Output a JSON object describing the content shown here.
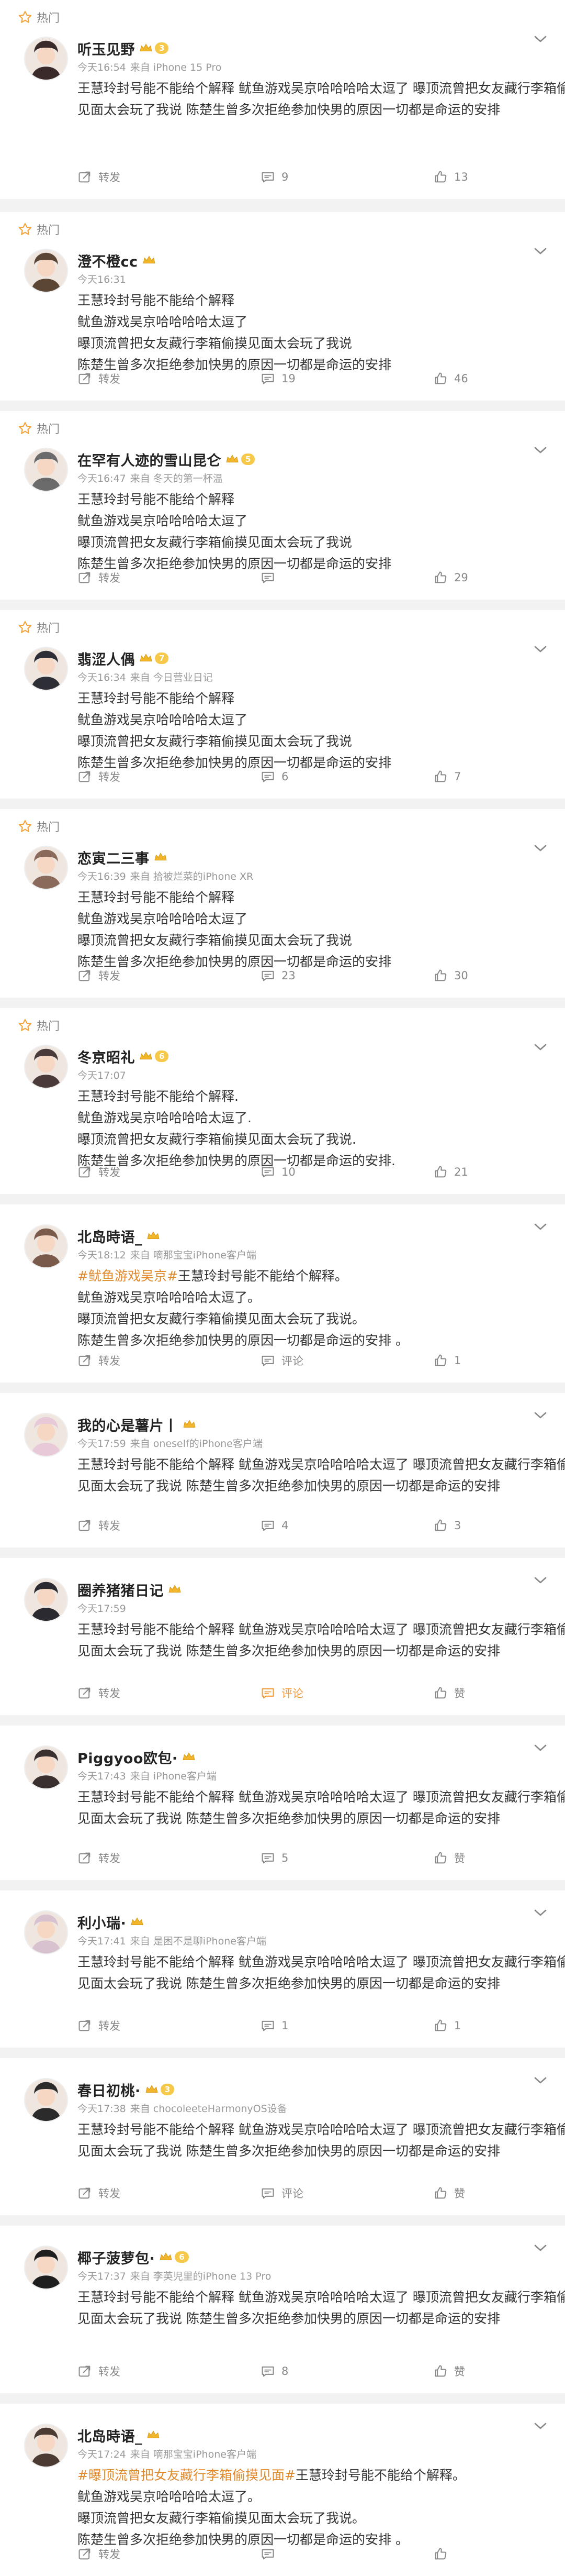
{
  "hot_label": "热门",
  "actions": {
    "forward": "转发",
    "comment_word": "评论",
    "like_word": "赞"
  },
  "colors": {
    "accent": "#f29a38",
    "tag": "#e08a2c",
    "text": "#333333",
    "meta": "#999999",
    "vip": "#f7c94a"
  },
  "icons": [
    "star-icon",
    "chevron-down-icon",
    "forward-icon",
    "comment-icon",
    "like-icon",
    "crown-icon"
  ],
  "comments": [
    {
      "hot": true,
      "name": "听玉见野",
      "vip": true,
      "vip_level": "3",
      "time": "今天16:54",
      "source": "来自 iPhone 15 Pro",
      "lines": [
        "王慧玲封号能不能给个解释 鱿鱼游戏吴京哈哈哈哈太逗了 曝顶流曾把女友藏行李箱偷摸",
        "见面太会玩了我说 陈楚生曾多次拒绝参加快男的原因一切都是命运的安排"
      ],
      "comments": "9",
      "likes": "13"
    },
    {
      "hot": true,
      "name": "澄不橙cc",
      "vip": true,
      "vip_level": "",
      "time": "今天16:31",
      "source": "",
      "lines": [
        "王慧玲封号能不能给个解释",
        "鱿鱼游戏吴京哈哈哈哈太逗了",
        "曝顶流曾把女友藏行李箱偷摸见面太会玩了我说",
        "陈楚生曾多次拒绝参加快男的原因一切都是命运的安排"
      ],
      "comments": "19",
      "likes": "46"
    },
    {
      "hot": true,
      "name": "在罕有人迹的雪山昆仑",
      "vip": true,
      "vip_level": "5",
      "time": "今天16:47",
      "source": "来自 冬天的第一杯温",
      "lines": [
        "王慧玲封号能不能给个解释",
        "鱿鱼游戏吴京哈哈哈哈太逗了",
        "曝顶流曾把女友藏行李箱偷摸见面太会玩了我说",
        "陈楚生曾多次拒绝参加快男的原因一切都是命运的安排"
      ],
      "comments": "",
      "likes": "29"
    },
    {
      "hot": true,
      "name": "翡涩人偶",
      "vip": true,
      "vip_level": "7",
      "time": "今天16:34",
      "source": "来自 今日营业日记",
      "lines": [
        "王慧玲封号能不能给个解释",
        "鱿鱼游戏吴京哈哈哈哈太逗了",
        "曝顶流曾把女友藏行李箱偷摸见面太会玩了我说",
        "陈楚生曾多次拒绝参加快男的原因一切都是命运的安排"
      ],
      "comments": "6",
      "likes": "7"
    },
    {
      "hot": true,
      "name": "恋寅二三事",
      "vip": true,
      "vip_level": "",
      "time": "今天16:39",
      "source": "来自 拾被烂菜的iPhone XR",
      "lines": [
        "王慧玲封号能不能给个解释",
        "鱿鱼游戏吴京哈哈哈哈太逗了",
        "曝顶流曾把女友藏行李箱偷摸见面太会玩了我说",
        "陈楚生曾多次拒绝参加快男的原因一切都是命运的安排"
      ],
      "comments": "23",
      "likes": "30"
    },
    {
      "hot": true,
      "name": "冬京昭礼",
      "vip": true,
      "vip_level": "6",
      "time": "今天17:07",
      "source": "",
      "lines": [
        "王慧玲封号能不能给个解释.",
        "鱿鱼游戏吴京哈哈哈哈太逗了.",
        "曝顶流曾把女友藏行李箱偷摸见面太会玩了我说.",
        "陈楚生曾多次拒绝参加快男的原因一切都是命运的安排."
      ],
      "comments": "10",
      "likes": "21"
    },
    {
      "hot": false,
      "name": "北岛時语_",
      "vip": true,
      "vip_level": "",
      "time": "今天18:12",
      "source": "来自 嘀那宝宝iPhone客户端",
      "tag": "#鱿鱼游戏吴京#",
      "lines": [
        "王慧玲封号能不能给个解释。",
        "鱿鱼游戏吴京哈哈哈哈太逗了。",
        "曝顶流曾把女友藏行李箱偷摸见面太会玩了我说。",
        "陈楚生曾多次拒绝参加快男的原因一切都是命运的安排 。"
      ],
      "comments": "评论",
      "likes": "1"
    },
    {
      "hot": false,
      "name": "我的心是薯片丨",
      "vip": true,
      "vip_level": "",
      "time": "今天17:59",
      "source": "来自 oneself的iPhone客户端",
      "lines": [
        "王慧玲封号能不能给个解释 鱿鱼游戏吴京哈哈哈哈太逗了 曝顶流曾把女友藏行李箱偷摸",
        "见面太会玩了我说 陈楚生曾多次拒绝参加快男的原因一切都是命运的安排"
      ],
      "comments": "4",
      "likes": "3"
    },
    {
      "hot": false,
      "name": "圈养猪猪日记",
      "vip": true,
      "vip_level": "",
      "time": "今天17:59",
      "source": "",
      "lines": [
        "王慧玲封号能不能给个解释 鱿鱼游戏吴京哈哈哈哈太逗了 曝顶流曾把女友藏行李箱偷摸",
        "见面太会玩了我说 陈楚生曾多次拒绝参加快男的原因一切都是命运的安排"
      ],
      "comments": "评论",
      "likes": "赞",
      "comment_highlight": true
    },
    {
      "hot": false,
      "name": "Piggyoo欧包·",
      "vip": true,
      "vip_level": "",
      "time": "今天17:43",
      "source": "来自 iPhone客户端",
      "lines": [
        "王慧玲封号能不能给个解释 鱿鱼游戏吴京哈哈哈哈太逗了 曝顶流曾把女友藏行李箱偷摸",
        "见面太会玩了我说 陈楚生曾多次拒绝参加快男的原因一切都是命运的安排"
      ],
      "comments": "5",
      "likes": "赞"
    },
    {
      "hot": false,
      "name": "利小瑞·",
      "vip": true,
      "vip_level": "",
      "time": "今天17:41",
      "source": "来自 是困不是聊iPhone客户端",
      "lines": [
        "王慧玲封号能不能给个解释 鱿鱼游戏吴京哈哈哈哈太逗了 曝顶流曾把女友藏行李箱偷摸",
        "见面太会玩了我说 陈楚生曾多次拒绝参加快男的原因一切都是命运的安排"
      ],
      "comments": "1",
      "likes": "1"
    },
    {
      "hot": false,
      "name": "春日初桃·",
      "vip": true,
      "vip_level": "3",
      "time": "今天17:38",
      "source": "来自 chocoleeteHarmonyOS设备",
      "lines": [
        "王慧玲封号能不能给个解释 鱿鱼游戏吴京哈哈哈哈太逗了 曝顶流曾把女友藏行李箱偷摸",
        "见面太会玩了我说 陈楚生曾多次拒绝参加快男的原因一切都是命运的安排"
      ],
      "comments": "评论",
      "likes": "赞"
    },
    {
      "hot": false,
      "name": "椰子菠萝包·",
      "vip": true,
      "vip_level": "6",
      "time": "今天17:37",
      "source": "来自 李英児里的iPhone 13 Pro",
      "lines": [
        "王慧玲封号能不能给个解释 鱿鱼游戏吴京哈哈哈哈太逗了 曝顶流曾把女友藏行李箱偷摸",
        "见面太会玩了我说 陈楚生曾多次拒绝参加快男的原因一切都是命运的安排"
      ],
      "comments": "8",
      "likes": "赞"
    },
    {
      "hot": false,
      "name": "北岛時语_",
      "vip": true,
      "vip_level": "",
      "time": "今天17:24",
      "source": "来自 嘀那宝宝iPhone客户端",
      "tag": "#曝顶流曾把女友藏行李箱偷摸见面#",
      "lines": [
        "王慧玲封号能不能给个解释。",
        "鱿鱼游戏吴京哈哈哈哈太逗了。",
        "曝顶流曾把女友藏行李箱偷摸见面太会玩了我说。",
        "陈楚生曾多次拒绝参加快男的原因一切都是命运的安排 。"
      ],
      "comments": "",
      "likes": ""
    }
  ]
}
